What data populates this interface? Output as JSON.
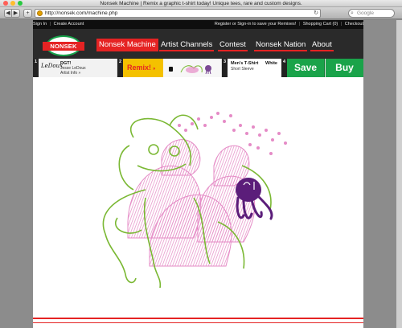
{
  "browser": {
    "window_title": "Nonsek Machine | Remix a graphic t-shirt today! Unique tees, rare and custom designs.",
    "url": "http://nonsek.com/machine.php",
    "search_placeholder": "Google",
    "back_glyph": "◀",
    "forward_glyph": "▶",
    "add_glyph": "+",
    "reload_glyph": "↻",
    "search_glyph": "⌕",
    "traffic_light_colors": [
      "#ff5f57",
      "#ffbd2e",
      "#28c940"
    ]
  },
  "utility_bar": {
    "sign_in": "Sign In",
    "create_account": "Create Account",
    "register_prompt": "Register or Sign-in to save your Remixes!",
    "shopping_cart": "Shopping Cart (0)",
    "checkout": "Checkout",
    "separator": "|"
  },
  "nav": {
    "logo_text": "NONSEK",
    "items": [
      "Nonsek Machine",
      "Artist Channels",
      "Contest",
      "Nonsek Nation",
      "About"
    ],
    "active": "Nonsek Machine"
  },
  "steps": {
    "numbers": [
      "1",
      "2",
      "3",
      "4"
    ],
    "artist": {
      "signature": "LeDoux",
      "design": "DGT!",
      "name": "Jesse LeDoux",
      "info_link": "Artist Info »"
    },
    "remix_label": "Remix!",
    "remix_arrow": "»",
    "shirt": {
      "type": "Men's T-Shirt",
      "sleeve": "Short Sleeve",
      "color": "White"
    },
    "save_label": "Save",
    "buy_label": "Buy"
  },
  "colors": {
    "brand_red": "#e52323",
    "brand_green": "#1aa34a",
    "remix_yellow": "#f4c100",
    "art_pink": "#e58bc6",
    "art_green": "#7ab833",
    "art_purple": "#5b1d7a"
  }
}
